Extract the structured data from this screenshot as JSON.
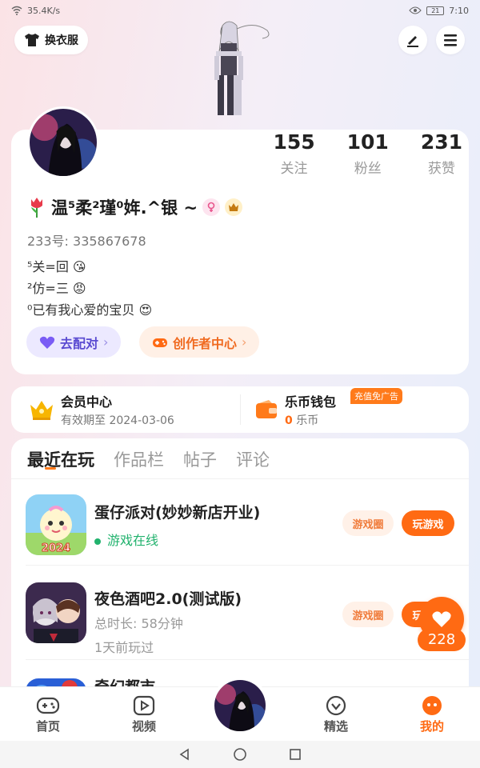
{
  "status_bar": {
    "speed": "35.4K/s",
    "battery": "21",
    "time": "7:10"
  },
  "header": {
    "outfit_label": "换衣服"
  },
  "profile": {
    "stats": [
      {
        "num": "155",
        "label": "关注"
      },
      {
        "num": "101",
        "label": "粉丝"
      },
      {
        "num": "231",
        "label": "获赞"
      }
    ],
    "nickname": "温⁵柔²瑾⁰姩.^银 ~",
    "uid": "233号:  335867678",
    "bio": [
      "⁵关=回",
      "²仿=三",
      "⁰已有我心爱的宝贝"
    ],
    "chips": {
      "match": "去配对",
      "creator": "创作者中心"
    }
  },
  "member": {
    "vip_title": "会员中心",
    "vip_sub": "有效期至 2024-03-06",
    "wallet_title": "乐币钱包",
    "wallet_amount": "0",
    "wallet_unit": "乐币",
    "ad_tag": "充值免广告"
  },
  "tabs": [
    "最近在玩",
    "作品栏",
    "帖子",
    "评论"
  ],
  "games": [
    {
      "name": "蛋仔派对(妙妙新店开业)",
      "status": "游戏在线",
      "btn1": "游戏圈",
      "btn2": "玩游戏",
      "icon_label": "2024"
    },
    {
      "name": "夜色酒吧2.0(测试版)",
      "duration": "总时长:  58分钟",
      "last": "1天前玩过",
      "btn1": "游戏圈",
      "btn2": "玩游戏"
    },
    {
      "name": "奇幻都市"
    }
  ],
  "float_count": "228",
  "bottom_nav": [
    {
      "label": "首页",
      "icon": "gamepad-icon"
    },
    {
      "label": "视频",
      "icon": "video-icon"
    },
    {
      "label": "精选",
      "icon": "heart-outline-icon"
    },
    {
      "label": "我的",
      "icon": "profile-face-icon"
    }
  ],
  "colors": {
    "accent": "#ff6a13",
    "online": "#21b26d",
    "chip_match_bg": "#ece9ff",
    "chip_creator_bg": "#fff0e6"
  }
}
